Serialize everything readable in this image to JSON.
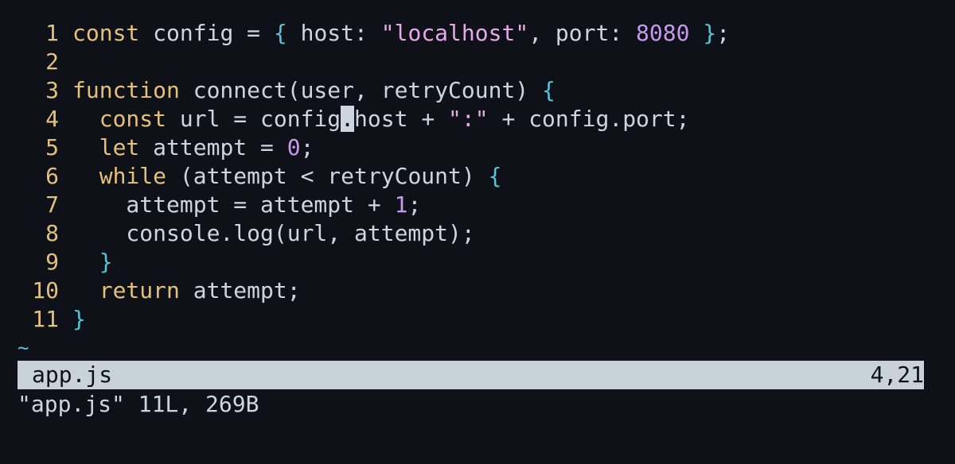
{
  "editor": {
    "lines": [
      {
        "num": "1",
        "tokens": [
          {
            "t": "const",
            "c": "kw"
          },
          {
            "t": " config = ",
            "c": "tx"
          },
          {
            "t": "{",
            "c": "br"
          },
          {
            "t": " host: ",
            "c": "tx"
          },
          {
            "t": "\"localhost\"",
            "c": "str"
          },
          {
            "t": ", port: ",
            "c": "tx"
          },
          {
            "t": "8080",
            "c": "num"
          },
          {
            "t": " ",
            "c": "tx"
          },
          {
            "t": "}",
            "c": "br"
          },
          {
            "t": ";",
            "c": "tx"
          }
        ]
      },
      {
        "num": "2",
        "tokens": []
      },
      {
        "num": "3",
        "tokens": [
          {
            "t": "function",
            "c": "kw"
          },
          {
            "t": " connect(user, retryCount) ",
            "c": "tx"
          },
          {
            "t": "{",
            "c": "br"
          }
        ]
      },
      {
        "num": "4",
        "tokens": [
          {
            "t": "  ",
            "c": "tx"
          },
          {
            "t": "const",
            "c": "kw"
          },
          {
            "t": " url = config",
            "c": "tx"
          },
          {
            "t": ".",
            "c": "cursor"
          },
          {
            "t": "host + ",
            "c": "tx"
          },
          {
            "t": "\":\"",
            "c": "str"
          },
          {
            "t": " + config.port;",
            "c": "tx"
          }
        ]
      },
      {
        "num": "5",
        "tokens": [
          {
            "t": "  ",
            "c": "tx"
          },
          {
            "t": "let",
            "c": "kw"
          },
          {
            "t": " attempt = ",
            "c": "tx"
          },
          {
            "t": "0",
            "c": "num"
          },
          {
            "t": ";",
            "c": "tx"
          }
        ]
      },
      {
        "num": "6",
        "tokens": [
          {
            "t": "  ",
            "c": "tx"
          },
          {
            "t": "while",
            "c": "kw"
          },
          {
            "t": " (attempt < retryCount) ",
            "c": "tx"
          },
          {
            "t": "{",
            "c": "br"
          }
        ]
      },
      {
        "num": "7",
        "tokens": [
          {
            "t": "    attempt = attempt + ",
            "c": "tx"
          },
          {
            "t": "1",
            "c": "num"
          },
          {
            "t": ";",
            "c": "tx"
          }
        ]
      },
      {
        "num": "8",
        "tokens": [
          {
            "t": "    console.log(url, attempt);",
            "c": "tx"
          }
        ]
      },
      {
        "num": "9",
        "tokens": [
          {
            "t": "  ",
            "c": "tx"
          },
          {
            "t": "}",
            "c": "br"
          }
        ]
      },
      {
        "num": "10",
        "tokens": [
          {
            "t": "  ",
            "c": "tx"
          },
          {
            "t": "return",
            "c": "kw"
          },
          {
            "t": " attempt;",
            "c": "tx"
          }
        ]
      },
      {
        "num": "11",
        "tokens": [
          {
            "t": "}",
            "c": "br"
          }
        ]
      }
    ],
    "empty_marker": "~"
  },
  "statusline": {
    "filename": "app.js",
    "position": "4,21"
  },
  "message": "\"app.js\" 11L, 269B",
  "colors": {
    "background": "#0e1117",
    "keyword": "#e5c07b",
    "string": "#e6a9e8",
    "number": "#c79af0",
    "bracket": "#56c3d8",
    "text": "#cdd6e0",
    "statusline_bg": "#c9d1d9"
  }
}
